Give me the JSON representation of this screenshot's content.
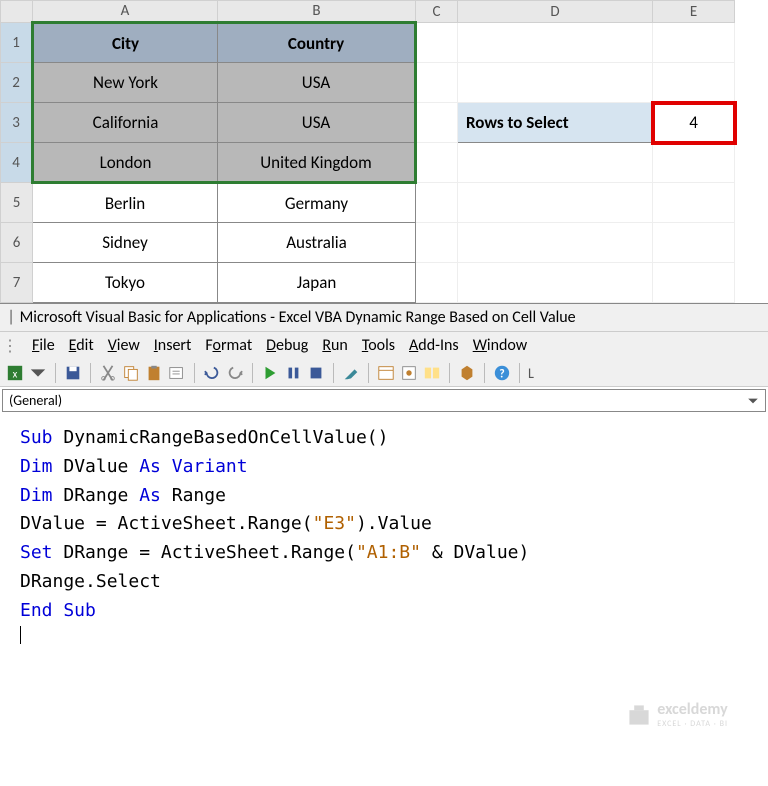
{
  "columns": {
    "a": "A",
    "b": "B",
    "c": "C",
    "d": "D",
    "e": "E"
  },
  "rows": {
    "r1": "1",
    "r2": "2",
    "r3": "3",
    "r4": "4",
    "r5": "5",
    "r6": "6",
    "r7": "7"
  },
  "table": {
    "header": {
      "city": "City",
      "country": "Country"
    },
    "data": [
      {
        "city": "New York",
        "country": "USA"
      },
      {
        "city": "California",
        "country": "USA"
      },
      {
        "city": "London",
        "country": "United Kingdom"
      },
      {
        "city": "Berlin",
        "country": "Germany"
      },
      {
        "city": "Sidney",
        "country": "Australia"
      },
      {
        "city": "Tokyo",
        "country": "Japan"
      }
    ]
  },
  "rows_select": {
    "label": "Rows to Select",
    "value": "4"
  },
  "vbe": {
    "title": "Microsoft Visual Basic for Applications - Excel VBA Dynamic Range Based on Cell Value",
    "menu": {
      "file": "File",
      "edit": "Edit",
      "view": "View",
      "insert": "Insert",
      "format": "Format",
      "debug": "Debug",
      "run": "Run",
      "tools": "Tools",
      "addins": "Add-Ins",
      "window": "Window"
    },
    "scope": "(General)",
    "code": {
      "l1a": "Sub",
      "l1b": " DynamicRangeBasedOnCellValue()",
      "l2a": "Dim",
      "l2b": " DValue ",
      "l2c": "As Variant",
      "l3a": "Dim",
      "l3b": " DRange ",
      "l3c": "As",
      "l3d": " Range",
      "l4a": "DValue = ActiveSheet.Range(",
      "l4b": "\"E3\"",
      "l4c": ").Value",
      "l5a": "Set",
      "l5b": " DRange = ActiveSheet.Range(",
      "l5c": "\"A1:B\"",
      "l5d": " & DValue)",
      "l6": "DRange.Select",
      "l7": "End Sub"
    }
  },
  "watermark": {
    "name": "exceldemy",
    "tag": "EXCEL · DATA · BI"
  }
}
